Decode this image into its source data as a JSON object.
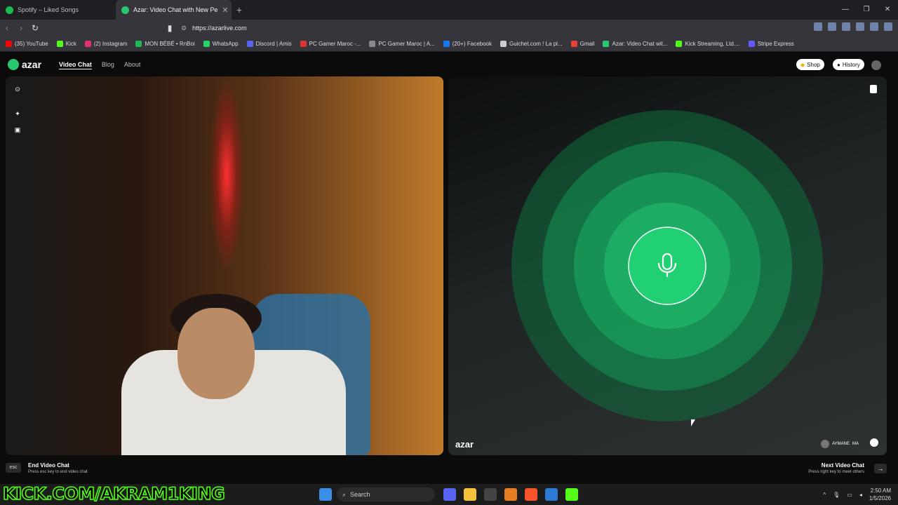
{
  "browser": {
    "tabs": [
      {
        "label": "Spotify – Liked Songs",
        "color": "#1db954"
      },
      {
        "label": "Azar: Video Chat with New Pe",
        "color": "#29c770"
      }
    ],
    "url": "https://azarlive.com"
  },
  "bookmarks": [
    {
      "label": "(35) YouTube",
      "color": "#ff0000"
    },
    {
      "label": "Kick",
      "color": "#53fc18"
    },
    {
      "label": "(2) Instagram",
      "color": "#e1306c"
    },
    {
      "label": "MON BÉBÉ • RnBoi",
      "color": "#1db954"
    },
    {
      "label": "WhatsApp",
      "color": "#25d366"
    },
    {
      "label": "Discord | Amis",
      "color": "#5865f2"
    },
    {
      "label": "PC Gamer Maroc -...",
      "color": "#d33"
    },
    {
      "label": "PC Gamer Maroc | A...",
      "color": "#888"
    },
    {
      "label": "(20+) Facebook",
      "color": "#1877f2"
    },
    {
      "label": "Guichet.com ! La pl...",
      "color": "#ccc"
    },
    {
      "label": "Gmail",
      "color": "#ea4335"
    },
    {
      "label": "Azar: Video Chat wit...",
      "color": "#29c770"
    },
    {
      "label": "Kick Streaming, Ltd....",
      "color": "#53fc18"
    },
    {
      "label": "Stripe Express",
      "color": "#635bff"
    }
  ],
  "site": {
    "logo": "azar",
    "nav": [
      "Video Chat",
      "Blog",
      "About"
    ],
    "shop": "Shop",
    "history": "History"
  },
  "right_panel": {
    "watermark": "azar",
    "peer_name": "AYMANE",
    "peer_country": "MA"
  },
  "bottom": {
    "esc_key": "esc",
    "end_title": "End Video Chat",
    "end_sub": "Press esc key to end video chat",
    "next_title": "Next Video Chat",
    "next_sub": "Press right key to meet others"
  },
  "overlay": {
    "kick_text": "KICK.COM/AKRAM1KING"
  },
  "taskbar": {
    "search": "Search",
    "time": "2:50 AM",
    "date": "1/5/2026"
  }
}
